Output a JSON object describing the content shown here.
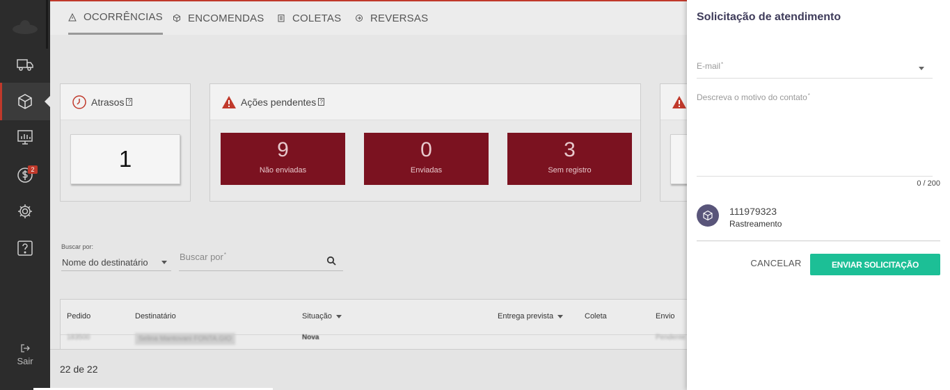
{
  "sidebar": {
    "logo": "cloud-logo",
    "items": [
      {
        "icon": "truck-icon"
      },
      {
        "icon": "package-icon",
        "active": true
      },
      {
        "icon": "chart-icon"
      },
      {
        "icon": "dollar-icon",
        "badge": "2"
      },
      {
        "icon": "gear-icon"
      },
      {
        "icon": "help-icon"
      }
    ],
    "logout_label": "Sair"
  },
  "tabs": [
    {
      "label": "OCORRÊNCIAS",
      "icon": "warning-icon",
      "active": true
    },
    {
      "label": "ENCOMENDAS",
      "icon": "box-icon"
    },
    {
      "label": "COLETAS",
      "icon": "clipboard-icon"
    },
    {
      "label": "REVERSAS",
      "icon": "return-icon"
    }
  ],
  "cards": {
    "atrasos": {
      "title": "Atrasos",
      "value": "1"
    },
    "acoes": {
      "title": "Ações pendentes",
      "stats": [
        {
          "value": "9",
          "label": "Não enviadas"
        },
        {
          "value": "0",
          "label": "Enviadas"
        },
        {
          "value": "3",
          "label": "Sem registro"
        }
      ]
    }
  },
  "search": {
    "label": "Buscar por:",
    "select_value": "Nome do destinatário",
    "input_placeholder": "Buscar por",
    "required_mark": "*"
  },
  "table": {
    "headers": {
      "pedido": "Pedido",
      "destinatario": "Destinatário",
      "situacao": "Situação",
      "entrega": "Entrega prevista",
      "coleta": "Coleta",
      "envio": "Envio"
    },
    "row": {
      "pedido": "183500",
      "destinatario": "Selina Mantovani FONTA.GIO",
      "situacao": "Nova",
      "envio": "Pendente"
    }
  },
  "footer": {
    "count": "22 de 22"
  },
  "panel": {
    "title": "Solicitação de atendimento",
    "email_label": "E-mail",
    "description_label": "Descreva o motivo do contato",
    "required_mark": "*",
    "counter": "0 / 200",
    "reference_number": "111979323",
    "reference_type": "Rastreamento",
    "cancel_label": "CANCELAR",
    "send_label": "ENVIAR SOLICITAÇÃO"
  },
  "colors": {
    "sidebar_bg": "#2c2c2c",
    "accent_red": "#7b1220",
    "brand_red": "#c0392b",
    "send_green": "#1cbf96",
    "panel_title": "#3e3b5a"
  }
}
